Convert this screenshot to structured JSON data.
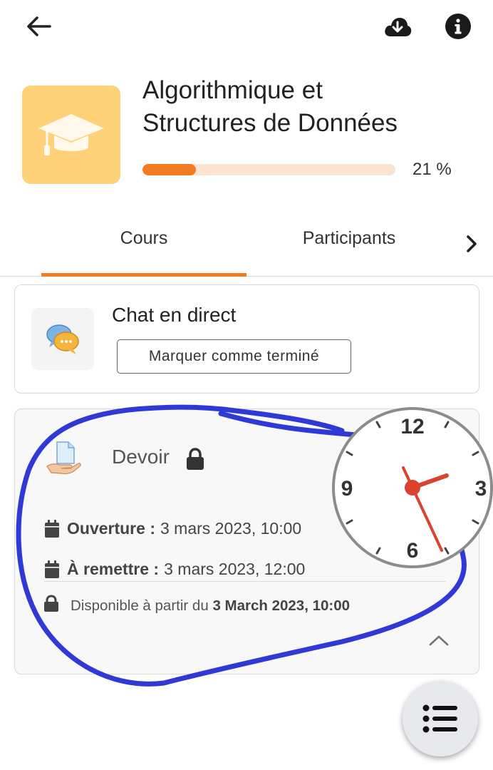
{
  "topbar": {
    "back_icon": "arrow-left-icon",
    "download_icon": "cloud-download-icon",
    "info_icon": "info-circle-icon"
  },
  "course": {
    "title_line1": "Algorithmique et",
    "title_line2": "Structures de Données",
    "progress_percent": 21,
    "progress_label": "21 %",
    "thumbnail_icon": "graduation-cap-icon",
    "accent_color": "#f47b20"
  },
  "tabs": {
    "items": [
      {
        "label": "Cours",
        "active": true
      },
      {
        "label": "Participants",
        "active": false
      }
    ],
    "next_icon": "chevron-right-icon"
  },
  "chat_module": {
    "title": "Chat en direct",
    "icon": "chat-bubbles-icon",
    "mark_done_label": "Marquer comme terminé"
  },
  "assignment_module": {
    "title": "Devoir",
    "icon": "assignment-hand-icon",
    "lock_icon": "lock-icon",
    "opening_label": "Ouverture :",
    "opening_value": "3 mars 2023, 10:00",
    "due_label": "À remettre :",
    "due_value": "3 mars 2023, 12:00",
    "availability_prefix": "Disponible à partir du",
    "availability_date": "3 March 2023, 10:00",
    "collapse_icon": "chevron-up-icon"
  },
  "clock_overlay": {
    "numbers": [
      "12",
      "3",
      "6",
      "9"
    ]
  },
  "fab": {
    "icon": "list-icon"
  }
}
